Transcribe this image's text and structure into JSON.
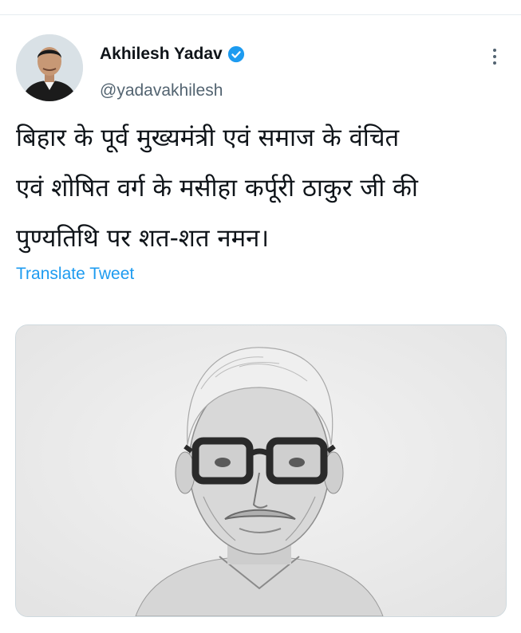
{
  "tweet": {
    "author_name": "Akhilesh Yadav",
    "author_handle": "@yadavakhilesh",
    "text": "बिहार के पूर्व मुख्यमंत्री एवं समाज के वंचित\nएवं शोषित वर्ग के मसीहा कर्पूरी ठाकुर जी की\nपुण्यतिथि पर शत-शत नमन।",
    "translate_label": "Translate Tweet",
    "verified": true
  },
  "icons": {
    "verified": "verified-badge-icon",
    "more": "more-options-icon"
  },
  "colors": {
    "link": "#1d9bf0",
    "secondary_text": "#536471",
    "primary_text": "#0f1419"
  }
}
